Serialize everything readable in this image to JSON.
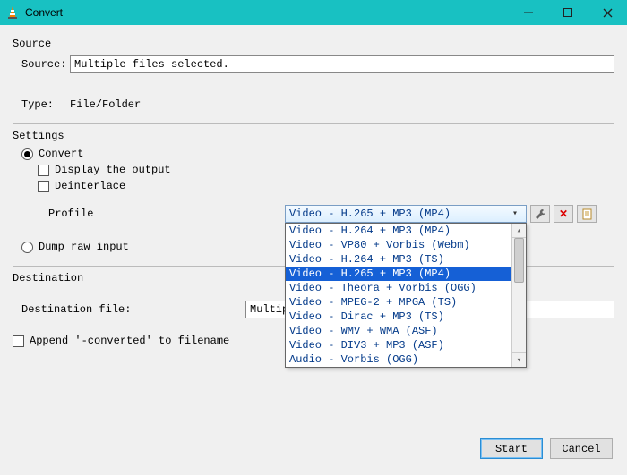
{
  "window": {
    "title": "Convert"
  },
  "source": {
    "section_label": "Source",
    "source_label": "Source:",
    "source_value": "Multiple files selected.",
    "type_label": "Type:",
    "type_value": "File/Folder"
  },
  "settings": {
    "section_label": "Settings",
    "convert_label": "Convert",
    "display_output_label": "Display the output",
    "deinterlace_label": "Deinterlace",
    "profile_label": "Profile",
    "profile_selected": "Video - H.265 + MP3 (MP4)",
    "profile_options": {
      "0": "Video - H.264 + MP3 (MP4)",
      "1": "Video - VP80 + Vorbis (Webm)",
      "2": "Video - H.264 + MP3 (TS)",
      "3": "Video - H.265 + MP3 (MP4)",
      "4": "Video - Theora + Vorbis (OGG)",
      "5": "Video - MPEG-2 + MPGA (TS)",
      "6": "Video - Dirac + MP3 (TS)",
      "7": "Video - WMV + WMA (ASF)",
      "8": "Video - DIV3 + MP3 (ASF)",
      "9": "Audio - Vorbis (OGG)"
    },
    "dump_raw_label": "Dump raw input"
  },
  "destination": {
    "section_label": "Destination",
    "dest_file_label": "Destination file:",
    "dest_file_value": "Multiple Fil",
    "append_label": "Append '-converted' to filename"
  },
  "buttons": {
    "start": "Start",
    "cancel": "Cancel"
  },
  "icons": {
    "wrench": "wrench-icon",
    "delete": "delete-icon",
    "new": "new-profile-icon"
  }
}
